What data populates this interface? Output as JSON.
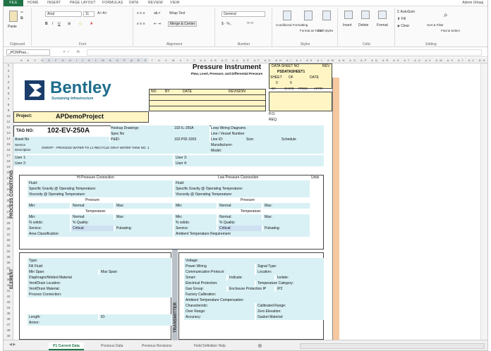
{
  "ribbon": {
    "tabs": [
      "FILE",
      "HOME",
      "INSERT",
      "PAGE LAYOUT",
      "FORMULAS",
      "DATA",
      "REVIEW",
      "VIEW"
    ],
    "user": "Admin Uhlaaj",
    "font_name": "Arial",
    "font_size": "11",
    "number_format": "General",
    "wrap_text": "Wrap Text",
    "merge_center": "Merge & Center",
    "conditional": "Conditional Formatting",
    "format_table": "Format as Table",
    "cell_styles": "Cell Styles",
    "insert": "Insert",
    "delete": "Delete",
    "format": "Format",
    "autosum": "AutoSum",
    "fill": "Fill",
    "clear": "Clear",
    "sort": "Sort & Filter",
    "find": "Find & Select",
    "paste": "Paste",
    "groups": [
      "Clipboard",
      "Font",
      "Alignment",
      "Number",
      "Styles",
      "Cells",
      "Editing"
    ]
  },
  "formula_bar": {
    "name_box": "_PCH/Pres...",
    "fx": "fx"
  },
  "sheet": {
    "title": "Pressure Instrument",
    "subtitle": "Flow, Level, Pressure, and Differential Pressure",
    "company": "Bentley",
    "tagline": "Sustaining Infrastructure",
    "data_sheet_no": "DATA SHEET NO",
    "rev": "REV",
    "sheet_code": "PSDATASHEET1",
    "sheet_lbl": "SHEET",
    "of_lbl": "OF",
    "date_lbl": "DATE",
    "sheet_no": "0",
    "of_no": "0",
    "rev_head": [
      "NO",
      "BY",
      "DATE",
      "REVISION"
    ],
    "sign_head": [
      "BY",
      "CHK'D",
      "PROC",
      "APPR"
    ],
    "project_lbl": "Project:",
    "project": "APDemoProject",
    "po": "P.O.",
    "req": "REQ.",
    "tag_lbl": "TAG NO:",
    "tag": "102-EV-250A",
    "hookup_lbl": "Hookup Drawings",
    "hookup": "102-IL-250A",
    "spec_lbl": "Spec No",
    "pid_lbl": "P&ID:",
    "pid": "102-PID-1003",
    "loop_lbl": "Loop Wiring Diagrams",
    "line_vessel": "Line / Vessel Number",
    "line_id": "Line ID:",
    "size": "Size:",
    "schedule": "Schedule",
    "asset": "Asset No",
    "service_lbl": "Service Description",
    "service": "ON/OFF - PROCESS WATER TO L1 RECYCLE GRAY WATER TANK NO. 1",
    "manufacturer": "Manufacturer:",
    "model": "Model:",
    "user1": "User 1:",
    "user2": "User 2:",
    "user3": "User 3:",
    "user4": "User 4:",
    "hi_head": "Hi Pressure Connection",
    "lo_head": "Low Pressure Connection",
    "units": "Units",
    "proc_side": "PROCESS CONDITIONS",
    "fluid": "Fluid:",
    "sg": "Specific Gravity @ Operating Temperature:",
    "visc": "Viscosity @ Operating Temperature:",
    "pressure": "Pressure",
    "min": "Min:",
    "normal": "Normal:",
    "max": "Max:",
    "temperature": "Temperature:",
    "solids": "% solids:",
    "quality": "% Quality:",
    "service2": "Service:",
    "critical": "Critical:",
    "pulsating": "Pulsating:",
    "area": "Area Classification:",
    "ambient": "Ambient Temperature Requirement",
    "elem_side": "ELEMENT",
    "type": "Type:",
    "fill_fluid": "Fill Fluid:",
    "min_span": "Min Span:",
    "max_span": "Max Span:",
    "diaphragm": "Diaphragm/Wetted Material",
    "vent_loc": "Vent/Drain Location:",
    "vent_mat": "Vent/Drain Material:",
    "proc_conn": "Process Connection:",
    "length": "Length:",
    "armor": "Armor:",
    "id": "ID:",
    "trans_side": "TRANSMITTER",
    "voltage": "Voltage:",
    "power": "Power Wiring",
    "signal": "Signal Type:",
    "comm": "Communication Protocol",
    "location": "Location:",
    "smart": "Smart:",
    "indicate": "Indicate:",
    "isolate": "Isolate:",
    "elec_prot": "Electrical Protection:",
    "temp_cat": "Temperature Category:",
    "gas_group": "Gas Group:",
    "encl": "Enclosure Protection IP",
    "ip": "IP2",
    "factory_cal": "Factory Calibration:",
    "ambient_comp": "Ambient Temperature Compensation:",
    "characteristic": "Characteristic:",
    "cal_range": "Calibrated Range:",
    "over_range": "Over Range:",
    "zero_elev": "Zero Elevation:",
    "accuracy": "Accuracy:",
    "gasket": "Gasket Material:"
  },
  "sheet_tabs": [
    "P1 Current Data",
    "Previous Data",
    "Previous Revisions",
    "Field Definition Help"
  ]
}
